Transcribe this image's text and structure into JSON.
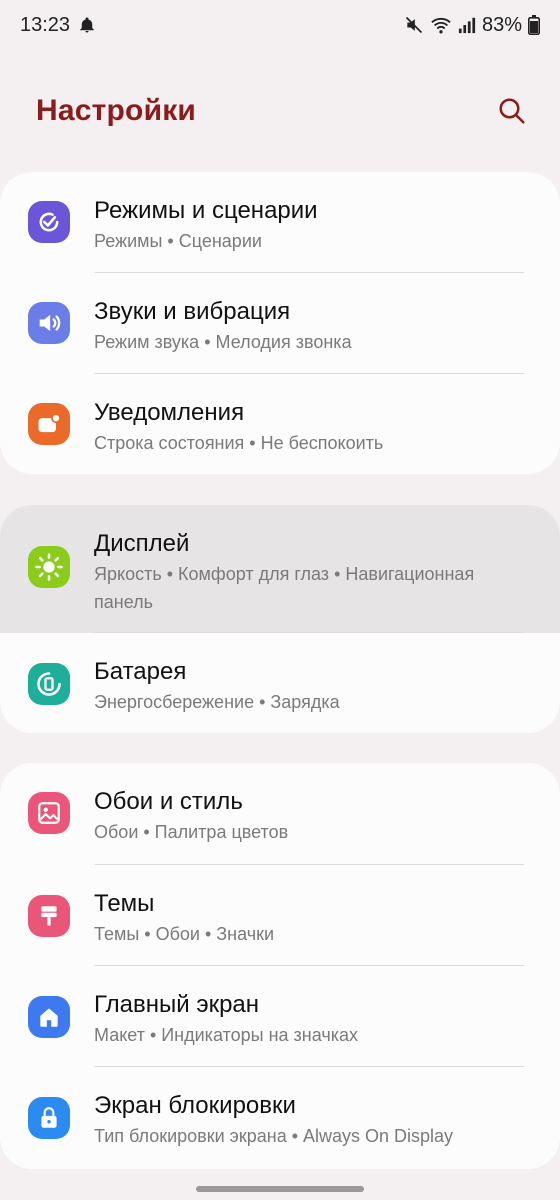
{
  "status_bar": {
    "time": "13:23",
    "battery": "83%"
  },
  "header": {
    "title": "Настройки"
  },
  "groups": [
    {
      "items": [
        {
          "title": "Режимы и сценарии",
          "subtitle": "Режимы  •  Сценарии",
          "icon": "modes-icon",
          "color": "#6b56d9"
        },
        {
          "title": "Звуки и вибрация",
          "subtitle": "Режим звука  •  Мелодия звонка",
          "icon": "volume-icon",
          "color": "#6b7de6"
        },
        {
          "title": "Уведомления",
          "subtitle": "Строка состояния  •  Не беспокоить",
          "icon": "notification-icon",
          "color": "#ea6a2a"
        }
      ]
    },
    {
      "items": [
        {
          "title": "Дисплей",
          "subtitle": "Яркость  •  Комфорт для глаз  •  Навигационная панель",
          "icon": "brightness-icon",
          "color": "#8bcb1c"
        },
        {
          "title": "Батарея",
          "subtitle": "Энергосбережение  •  Зарядка",
          "icon": "battery-icon",
          "color": "#1fae9a"
        }
      ]
    },
    {
      "items": [
        {
          "title": "Обои и стиль",
          "subtitle": "Обои  •  Палитра цветов",
          "icon": "wallpaper-icon",
          "color": "#e9567a"
        },
        {
          "title": "Темы",
          "subtitle": "Темы  •  Обои  •  Значки",
          "icon": "themes-icon",
          "color": "#e9567a"
        },
        {
          "title": "Главный экран",
          "subtitle": "Макет  •  Индикаторы на значках",
          "icon": "home-icon",
          "color": "#3f79f0"
        },
        {
          "title": "Экран блокировки",
          "subtitle": "Тип блокировки экрана  •  Always On Display",
          "icon": "lock-icon",
          "color": "#2b8bf0"
        }
      ]
    }
  ]
}
